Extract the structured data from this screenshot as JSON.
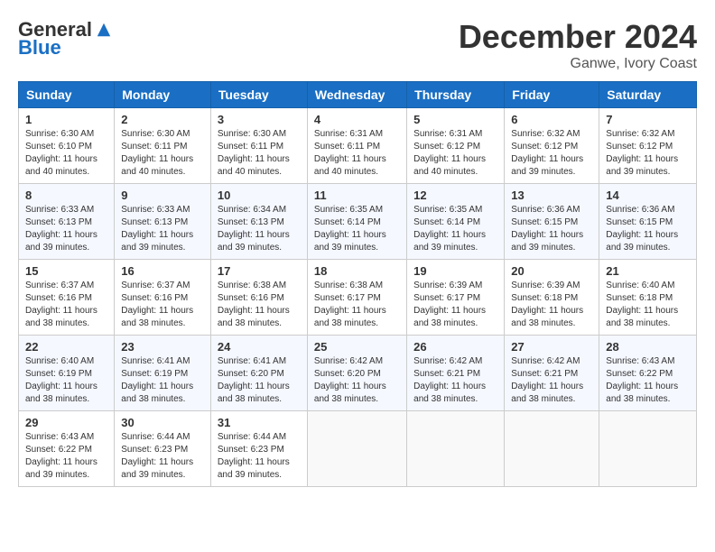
{
  "logo": {
    "general": "General",
    "blue": "Blue"
  },
  "title": "December 2024",
  "subtitle": "Ganwe, Ivory Coast",
  "days_header": [
    "Sunday",
    "Monday",
    "Tuesday",
    "Wednesday",
    "Thursday",
    "Friday",
    "Saturday"
  ],
  "weeks": [
    [
      {
        "day": "1",
        "sunrise": "6:30 AM",
        "sunset": "6:10 PM",
        "daylight": "11 hours and 40 minutes."
      },
      {
        "day": "2",
        "sunrise": "6:30 AM",
        "sunset": "6:11 PM",
        "daylight": "11 hours and 40 minutes."
      },
      {
        "day": "3",
        "sunrise": "6:30 AM",
        "sunset": "6:11 PM",
        "daylight": "11 hours and 40 minutes."
      },
      {
        "day": "4",
        "sunrise": "6:31 AM",
        "sunset": "6:11 PM",
        "daylight": "11 hours and 40 minutes."
      },
      {
        "day": "5",
        "sunrise": "6:31 AM",
        "sunset": "6:12 PM",
        "daylight": "11 hours and 40 minutes."
      },
      {
        "day": "6",
        "sunrise": "6:32 AM",
        "sunset": "6:12 PM",
        "daylight": "11 hours and 39 minutes."
      },
      {
        "day": "7",
        "sunrise": "6:32 AM",
        "sunset": "6:12 PM",
        "daylight": "11 hours and 39 minutes."
      }
    ],
    [
      {
        "day": "8",
        "sunrise": "6:33 AM",
        "sunset": "6:13 PM",
        "daylight": "11 hours and 39 minutes."
      },
      {
        "day": "9",
        "sunrise": "6:33 AM",
        "sunset": "6:13 PM",
        "daylight": "11 hours and 39 minutes."
      },
      {
        "day": "10",
        "sunrise": "6:34 AM",
        "sunset": "6:13 PM",
        "daylight": "11 hours and 39 minutes."
      },
      {
        "day": "11",
        "sunrise": "6:35 AM",
        "sunset": "6:14 PM",
        "daylight": "11 hours and 39 minutes."
      },
      {
        "day": "12",
        "sunrise": "6:35 AM",
        "sunset": "6:14 PM",
        "daylight": "11 hours and 39 minutes."
      },
      {
        "day": "13",
        "sunrise": "6:36 AM",
        "sunset": "6:15 PM",
        "daylight": "11 hours and 39 minutes."
      },
      {
        "day": "14",
        "sunrise": "6:36 AM",
        "sunset": "6:15 PM",
        "daylight": "11 hours and 39 minutes."
      }
    ],
    [
      {
        "day": "15",
        "sunrise": "6:37 AM",
        "sunset": "6:16 PM",
        "daylight": "11 hours and 38 minutes."
      },
      {
        "day": "16",
        "sunrise": "6:37 AM",
        "sunset": "6:16 PM",
        "daylight": "11 hours and 38 minutes."
      },
      {
        "day": "17",
        "sunrise": "6:38 AM",
        "sunset": "6:16 PM",
        "daylight": "11 hours and 38 minutes."
      },
      {
        "day": "18",
        "sunrise": "6:38 AM",
        "sunset": "6:17 PM",
        "daylight": "11 hours and 38 minutes."
      },
      {
        "day": "19",
        "sunrise": "6:39 AM",
        "sunset": "6:17 PM",
        "daylight": "11 hours and 38 minutes."
      },
      {
        "day": "20",
        "sunrise": "6:39 AM",
        "sunset": "6:18 PM",
        "daylight": "11 hours and 38 minutes."
      },
      {
        "day": "21",
        "sunrise": "6:40 AM",
        "sunset": "6:18 PM",
        "daylight": "11 hours and 38 minutes."
      }
    ],
    [
      {
        "day": "22",
        "sunrise": "6:40 AM",
        "sunset": "6:19 PM",
        "daylight": "11 hours and 38 minutes."
      },
      {
        "day": "23",
        "sunrise": "6:41 AM",
        "sunset": "6:19 PM",
        "daylight": "11 hours and 38 minutes."
      },
      {
        "day": "24",
        "sunrise": "6:41 AM",
        "sunset": "6:20 PM",
        "daylight": "11 hours and 38 minutes."
      },
      {
        "day": "25",
        "sunrise": "6:42 AM",
        "sunset": "6:20 PM",
        "daylight": "11 hours and 38 minutes."
      },
      {
        "day": "26",
        "sunrise": "6:42 AM",
        "sunset": "6:21 PM",
        "daylight": "11 hours and 38 minutes."
      },
      {
        "day": "27",
        "sunrise": "6:42 AM",
        "sunset": "6:21 PM",
        "daylight": "11 hours and 38 minutes."
      },
      {
        "day": "28",
        "sunrise": "6:43 AM",
        "sunset": "6:22 PM",
        "daylight": "11 hours and 38 minutes."
      }
    ],
    [
      {
        "day": "29",
        "sunrise": "6:43 AM",
        "sunset": "6:22 PM",
        "daylight": "11 hours and 39 minutes."
      },
      {
        "day": "30",
        "sunrise": "6:44 AM",
        "sunset": "6:23 PM",
        "daylight": "11 hours and 39 minutes."
      },
      {
        "day": "31",
        "sunrise": "6:44 AM",
        "sunset": "6:23 PM",
        "daylight": "11 hours and 39 minutes."
      },
      null,
      null,
      null,
      null
    ]
  ]
}
